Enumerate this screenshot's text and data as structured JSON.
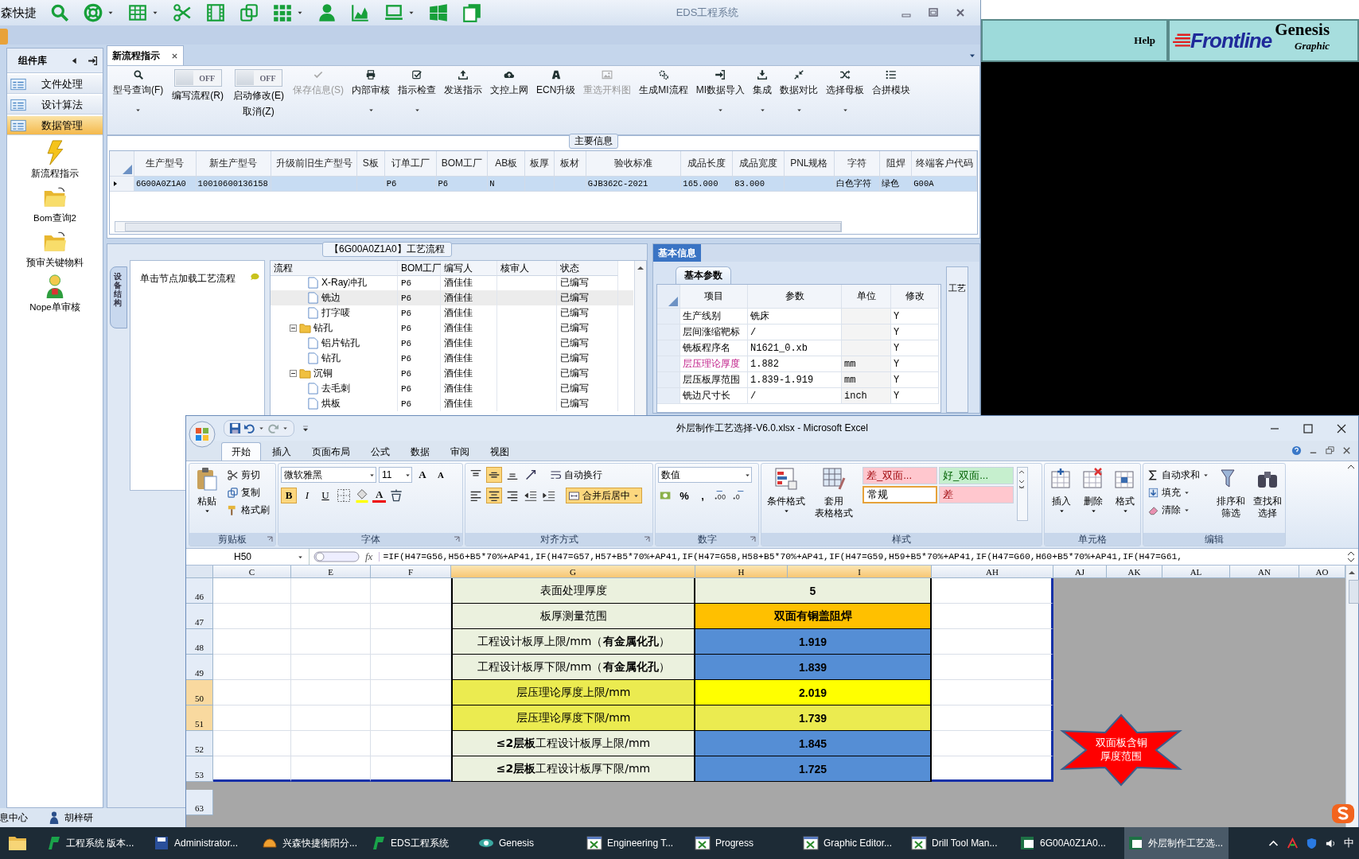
{
  "eds_window": {
    "title": "EDS工程系统",
    "quick_label": "森快捷",
    "toolbar": [
      {
        "dropdown": false
      },
      {
        "dropdown": true
      },
      {
        "dropdown": true
      },
      {
        "dropdown": false
      },
      {
        "dropdown": false
      },
      {
        "dropdown": false
      },
      {
        "dropdown": true
      },
      {
        "dropdown": false
      },
      {
        "dropdown": false
      },
      {
        "dropdown": true
      },
      {
        "dropdown": false
      },
      {
        "dropdown": false
      }
    ],
    "sidebar": {
      "title": "组件库",
      "groups": [
        {
          "label": "文件处理",
          "selected": false
        },
        {
          "label": "设计算法",
          "selected": false
        },
        {
          "label": "数据管理",
          "selected": true
        }
      ],
      "shortcuts": [
        {
          "label": "新流程指示",
          "kind": "bolt"
        },
        {
          "label": "Bom查询2",
          "kind": "folder"
        },
        {
          "label": "预审关键物料",
          "kind": "folder"
        },
        {
          "label": "Nope单审核",
          "kind": "user"
        }
      ]
    },
    "tabs": [
      {
        "label": "新流程指示",
        "selected": true
      }
    ],
    "ribbon": [
      {
        "kind": "button",
        "label": "型号查询(F)",
        "dropdown": true,
        "disabled": false
      },
      {
        "kind": "toggle",
        "switch": "OFF",
        "label": "编写流程(R)",
        "on": false
      },
      {
        "kind": "toggle",
        "switch": "OFF",
        "label": "启动修改(E)",
        "sublabel": "取消(Z)",
        "on": false
      },
      {
        "kind": "button",
        "label": "保存信息(S)",
        "dropdown": false,
        "disabled": true
      },
      {
        "kind": "button",
        "label": "内部审核",
        "dropdown": true,
        "disabled": false
      },
      {
        "kind": "button",
        "label": "指示检查",
        "dropdown": true,
        "disabled": false
      },
      {
        "kind": "button",
        "label": "发送指示",
        "dropdown": false,
        "disabled": false
      },
      {
        "kind": "button",
        "label": "文控上网",
        "dropdown": false,
        "disabled": false
      },
      {
        "kind": "button",
        "label": "ECN升级",
        "dropdown": false,
        "disabled": false
      },
      {
        "kind": "button",
        "label": "重选开料图",
        "dropdown": false,
        "disabled": true
      },
      {
        "kind": "button",
        "label": "生成MI流程",
        "dropdown": false,
        "disabled": false
      },
      {
        "kind": "button",
        "label": "MI数据导入",
        "dropdown": true,
        "disabled": false
      },
      {
        "kind": "button",
        "label": "集成",
        "dropdown": true,
        "disabled": false
      },
      {
        "kind": "button",
        "label": "数据对比",
        "dropdown": true,
        "disabled": false
      },
      {
        "kind": "button",
        "label": "选择母板",
        "dropdown": true,
        "disabled": false
      },
      {
        "kind": "button",
        "label": "合拼模块",
        "dropdown": false,
        "disabled": false
      }
    ],
    "main_info": {
      "title": "主要信息",
      "columns": [
        "生产型号",
        "新生产型号",
        "升级前旧生产型号",
        "S板",
        "订单工厂",
        "BOM工厂",
        "AB板",
        "板厚",
        "板材",
        "验收标准",
        "成品长度",
        "成品宽度",
        "PNL规格",
        "字符",
        "阻焊",
        "终端客户代码"
      ],
      "rows": [
        {
          "selected": true,
          "cells": [
            "6G00A0Z1A0",
            "10010600136158",
            null,
            null,
            "P6",
            "P6",
            "N",
            null,
            null,
            "GJB362C-2021",
            "165.000",
            "83.000",
            null,
            "白色字符",
            "绿色",
            "G00A"
          ]
        }
      ]
    },
    "process": {
      "title": "【6G00A0Z1A0】工艺流程",
      "side_tab": "设备结构",
      "hint": "单击节点加载工艺流程",
      "columns": [
        "流程",
        "BOM工厂",
        "编写人",
        "核审人",
        "状态"
      ],
      "rows": [
        {
          "kind": "file",
          "label": "X-Ray冲孔",
          "bom": "P6",
          "author": "酒佳佳",
          "status": "已编写",
          "selected": false
        },
        {
          "kind": "file",
          "label": "铣边",
          "bom": "P6",
          "author": "酒佳佳",
          "status": "已编写",
          "selected": true
        },
        {
          "kind": "file",
          "label": "打字唛",
          "bom": "P6",
          "author": "酒佳佳",
          "status": "已编写",
          "selected": false
        },
        {
          "kind": "folder",
          "label": "钻孔",
          "bom": "P6",
          "author": "酒佳佳",
          "status": "已编写",
          "selected": false,
          "expanded": true,
          "children": [
            {
              "kind": "file",
              "label": "铝片钻孔",
              "bom": "P6",
              "author": "酒佳佳",
              "status": "已编写",
              "selected": false
            },
            {
              "kind": "file",
              "label": "钻孔",
              "bom": "P6",
              "author": "酒佳佳",
              "status": "已编写",
              "selected": false
            }
          ]
        },
        {
          "kind": "folder",
          "label": "沉铜",
          "bom": "P6",
          "author": "酒佳佳",
          "status": "已编写",
          "selected": false,
          "expanded": true,
          "children": [
            {
              "kind": "file",
              "label": "去毛刺",
              "bom": "P6",
              "author": "酒佳佳",
              "status": "已编写",
              "selected": false
            },
            {
              "kind": "file",
              "label": "烘板",
              "bom": "P6",
              "author": "酒佳佳",
              "status": "已编写",
              "selected": false
            }
          ]
        }
      ]
    },
    "basic_info": {
      "tabs": [
        {
          "label": "基本信息",
          "selected": true
        }
      ],
      "subtab": "基本参数",
      "side_tab": "工艺",
      "columns": [
        "项目",
        "参数",
        "单位",
        "修改"
      ],
      "rows": [
        {
          "item": "生产线别",
          "value": "铣床",
          "edit": "Y",
          "highlight": false
        },
        {
          "item": "层间涨缩靶标",
          "value": "/",
          "edit": "Y",
          "highlight": false
        },
        {
          "item": "铣板程序名",
          "value": "N1621_0.xb",
          "edit": "Y",
          "highlight": false
        },
        {
          "item": "层压理论厚度",
          "value": "1.882",
          "unit": "mm",
          "edit": "Y",
          "highlight": true
        },
        {
          "item": "层压板厚范围",
          "value": "1.839-1.919",
          "unit": "mm",
          "edit": "Y",
          "highlight": false
        },
        {
          "item": "铣边尺寸长",
          "value": "/",
          "unit": "inch",
          "edit": "Y",
          "highlight": false
        }
      ]
    },
    "status": {
      "info": "息中心",
      "user": "胡梓研"
    }
  },
  "genesis": {
    "help": "Help",
    "logo": "Frontline",
    "product": "Genesis",
    "subtitle": "Graphic"
  },
  "excel": {
    "title": "外层制作工艺选择-V6.0.xlsx - Microsoft Excel",
    "tabs": [
      {
        "label": "开始",
        "selected": true
      },
      {
        "label": "插入",
        "selected": false
      },
      {
        "label": "页面布局",
        "selected": false
      },
      {
        "label": "公式",
        "selected": false
      },
      {
        "label": "数据",
        "selected": false
      },
      {
        "label": "审阅",
        "selected": false
      },
      {
        "label": "视图",
        "selected": false
      }
    ],
    "clipboard": {
      "title": "剪贴板",
      "paste": "粘贴",
      "cut": "剪切",
      "copy": "复制",
      "painter": "格式刷"
    },
    "font": {
      "title": "字体",
      "family": "微软雅黑",
      "size": "11",
      "grow": "A",
      "shrink": "A",
      "styles": [
        {
          "label": "B",
          "on": true
        },
        {
          "label": "I",
          "on": false
        },
        {
          "label": "U",
          "on": false
        }
      ],
      "color_letter": "A"
    },
    "alignment": {
      "title": "对齐方式",
      "vertical": [
        {
          "selected": false
        },
        {
          "selected": true
        },
        {
          "selected": false
        }
      ],
      "horizontal": [
        {
          "selected": false
        },
        {
          "selected": true
        },
        {
          "selected": false
        }
      ],
      "wrap": {
        "label": "自动换行",
        "on": false
      },
      "merge": {
        "label": "合并后居中",
        "on": true
      }
    },
    "number": {
      "title": "数字",
      "format": "数值",
      "percent": "%",
      "comma": ","
    },
    "styles": {
      "title": "样式",
      "conditional": "条件格式",
      "table_lines": [
        "套用",
        "表格格式"
      ],
      "cells": [
        {
          "label": "差_双面...",
          "color": "#ffc7ce",
          "kind": "bad",
          "selected": false
        },
        {
          "label": "好_双面...",
          "color": "#c6efce",
          "kind": "good",
          "selected": false
        },
        {
          "label": "常规",
          "color": "#ffffff",
          "kind": "neutral",
          "selected": true
        },
        {
          "label": "差",
          "color": "#ffc7ce",
          "kind": "bad",
          "selected": false
        }
      ]
    },
    "cells": {
      "title": "单元格",
      "buttons": [
        "插入",
        "删除",
        "格式"
      ]
    },
    "editing": {
      "title": "编辑",
      "small": [
        "自动求和",
        "填充",
        "清除"
      ],
      "big": [
        [
          "排序和",
          "筛选"
        ],
        [
          "查找和",
          "选择"
        ]
      ]
    },
    "formula_bar": {
      "name_box": "H50",
      "fx": "fx",
      "formula": "=IF(H47=G56,H56+B5*70%+AP41,IF(H47=G57,H57+B5*70%+AP41,IF(H47=G58,H58+B5*70%+AP41,IF(H47=G59,H59+B5*70%+AP41,IF(H47=G60,H60+B5*70%+AP41,IF(H47=G61,"
    },
    "sheet": {
      "columns": [
        {
          "label": "C",
          "selected": false
        },
        {
          "label": "E",
          "selected": false
        },
        {
          "label": "F",
          "selected": false
        },
        {
          "label": "G",
          "selected": true
        },
        {
          "label": "H",
          "selected": true
        },
        {
          "label": "I",
          "selected": true
        },
        {
          "label": "AH",
          "selected": false
        },
        {
          "label": "AJ",
          "selected": false
        },
        {
          "label": "AK",
          "selected": false
        },
        {
          "label": "AL",
          "selected": false
        },
        {
          "label": "AN",
          "selected": false
        },
        {
          "label": "AO",
          "selected": false
        }
      ],
      "rows": [
        {
          "row": "46",
          "selected": false,
          "kind": "info",
          "label": "表面处理厚度",
          "value": "5",
          "color": "#ebf1de"
        },
        {
          "row": "47",
          "selected": false,
          "kind": "info",
          "label": "板厚测量范围",
          "value": "双面有铜盖阻焊",
          "color": "#ffc000"
        },
        {
          "row": "48",
          "selected": false,
          "kind": "info",
          "label": "工程设计板厚上限/mm（**有金属化孔**）",
          "value": "1.919",
          "color": "#558ed5"
        },
        {
          "row": "49",
          "selected": false,
          "kind": "info",
          "label": "工程设计板厚下限/mm（**有金属化孔**）",
          "value": "1.839",
          "color": "#558ed5"
        },
        {
          "row": "50",
          "selected": true,
          "kind": "pressed",
          "label": "层压理论厚度上限/mm",
          "value": "2.019",
          "color": "#ffff00"
        },
        {
          "row": "51",
          "selected": true,
          "kind": "pressed",
          "label": "层压理论厚度下限/mm",
          "value": "1.739",
          "color": "#ebeb50"
        },
        {
          "row": "52",
          "selected": false,
          "kind": "warn",
          "label": "**≤2层板**工程设计板厚上限/mm",
          "value": "1.845",
          "color": "#558ed5"
        },
        {
          "row": "53",
          "selected": false,
          "kind": "info",
          "label": "**≤2层板**工程设计板厚下限/mm",
          "value": "1.725",
          "color": "#558ed5"
        }
      ],
      "extra_rows": [
        "63"
      ],
      "shape": {
        "text": "双面板含铜厚度范围"
      }
    }
  },
  "taskbar": {
    "items": [
      {
        "label": "工程系统  版本...",
        "selected": false
      },
      {
        "label": "Administrator...",
        "selected": false
      },
      {
        "label": "兴森快捷衡阳分...",
        "selected": false
      },
      {
        "label": "EDS工程系统",
        "selected": false
      },
      {
        "label": "Genesis",
        "selected": false
      },
      {
        "label": "Engineering T...",
        "selected": false
      },
      {
        "label": "Progress",
        "selected": false
      },
      {
        "label": "Graphic Editor...",
        "selected": false
      },
      {
        "label": "Drill Tool Man...",
        "selected": false
      },
      {
        "label": "6G00A0Z1A0...",
        "selected": false
      },
      {
        "label": "外层制作工艺选...",
        "selected": true
      }
    ],
    "ime": "中"
  }
}
